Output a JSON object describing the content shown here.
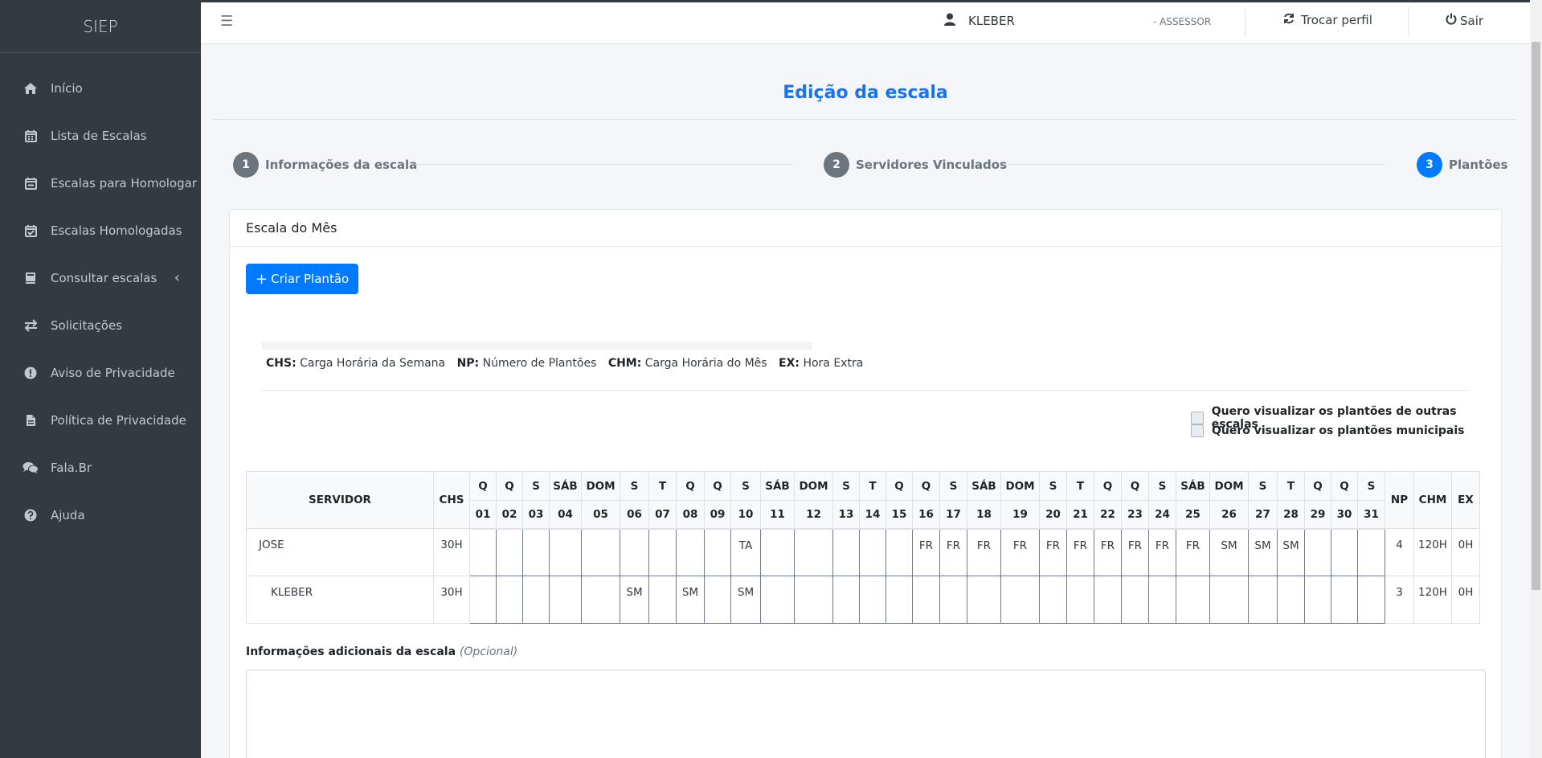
{
  "brand": "SIEP",
  "sidebar": {
    "items": [
      {
        "label": "Início",
        "icon": "home-icon"
      },
      {
        "label": "Lista de Escalas",
        "icon": "calendar-icon"
      },
      {
        "label": "Escalas para Homologar",
        "icon": "calendar-minus-icon"
      },
      {
        "label": "Escalas Homologadas",
        "icon": "calendar-check-icon"
      },
      {
        "label": "Consultar escalas",
        "icon": "book-icon"
      },
      {
        "label": "Solicitações",
        "icon": "exchange-icon"
      },
      {
        "label": "Aviso de Privacidade",
        "icon": "exclamation-circle-icon"
      },
      {
        "label": "Política de Privacidade",
        "icon": "file-icon"
      },
      {
        "label": "Fala.Br",
        "icon": "comments-icon"
      },
      {
        "label": "Ajuda",
        "icon": "question-circle-icon"
      }
    ]
  },
  "topbar": {
    "user": "KLEBER",
    "role": "- ASSESSOR",
    "switch_profile": "Trocar perfil",
    "logout": "Sair"
  },
  "page": {
    "title": "Edição da escala",
    "steps": [
      {
        "num": "1",
        "label": "Informações da escala"
      },
      {
        "num": "2",
        "label": "Servidores Vinculados"
      },
      {
        "num": "3",
        "label": "Plantões"
      }
    ],
    "card_title": "Escala do Mês",
    "create_button": "Criar Plantão",
    "legend": [
      {
        "abbr": "CHS:",
        "text": "Carga Horária da Semana"
      },
      {
        "abbr": "NP:",
        "text": "Número de Plantões"
      },
      {
        "abbr": "CHM:",
        "text": "Carga Horária do Mês"
      },
      {
        "abbr": "EX:",
        "text": "Hora Extra"
      }
    ],
    "checkboxes": [
      "Quero visualizar os plantões de outras escalas",
      "Quero visualizar os plantões municipais"
    ],
    "info_label": "Informações adicionais da escala",
    "info_optional": "(Opcional)"
  },
  "table": {
    "col_servidor": "SERVIDOR",
    "col_chs": "CHS",
    "col_np": "NP",
    "col_chm": "CHM",
    "col_ex": "EX",
    "weekdays": [
      "Q",
      "Q",
      "S",
      "SÁB",
      "DOM",
      "S",
      "T",
      "Q",
      "Q",
      "S",
      "SÁB",
      "DOM",
      "S",
      "T",
      "Q",
      "Q",
      "S",
      "SÁB",
      "DOM",
      "S",
      "T",
      "Q",
      "Q",
      "S",
      "SÁB",
      "DOM",
      "S",
      "T",
      "Q",
      "Q",
      "S"
    ],
    "days": [
      "01",
      "02",
      "03",
      "04",
      "05",
      "06",
      "07",
      "08",
      "09",
      "10",
      "11",
      "12",
      "13",
      "14",
      "15",
      "16",
      "17",
      "18",
      "19",
      "20",
      "21",
      "22",
      "23",
      "24",
      "25",
      "26",
      "27",
      "28",
      "29",
      "30",
      "31"
    ],
    "rows": [
      {
        "name": "JOSE",
        "chs": "30H",
        "cells": [
          "",
          "",
          "",
          "",
          "",
          "",
          "",
          "",
          "",
          "TA",
          "",
          "",
          "",
          "",
          "",
          "FR",
          "FR",
          "FR",
          "FR",
          "FR",
          "FR",
          "FR",
          "FR",
          "FR",
          "FR",
          "SM",
          "SM",
          "SM",
          "",
          "",
          ""
        ],
        "np": "4",
        "chm": "120H",
        "ex": "0H"
      },
      {
        "name": "KLEBER",
        "chs": "30H",
        "cells": [
          "",
          "",
          "",
          "",
          "",
          "SM",
          "",
          "SM",
          "",
          "SM",
          "",
          "",
          "",
          "",
          "",
          "",
          "",
          "",
          "",
          "",
          "",
          "",
          "",
          "",
          "",
          "",
          "",
          "",
          "",
          "",
          ""
        ],
        "np": "3",
        "chm": "120H",
        "ex": "0H"
      }
    ]
  }
}
